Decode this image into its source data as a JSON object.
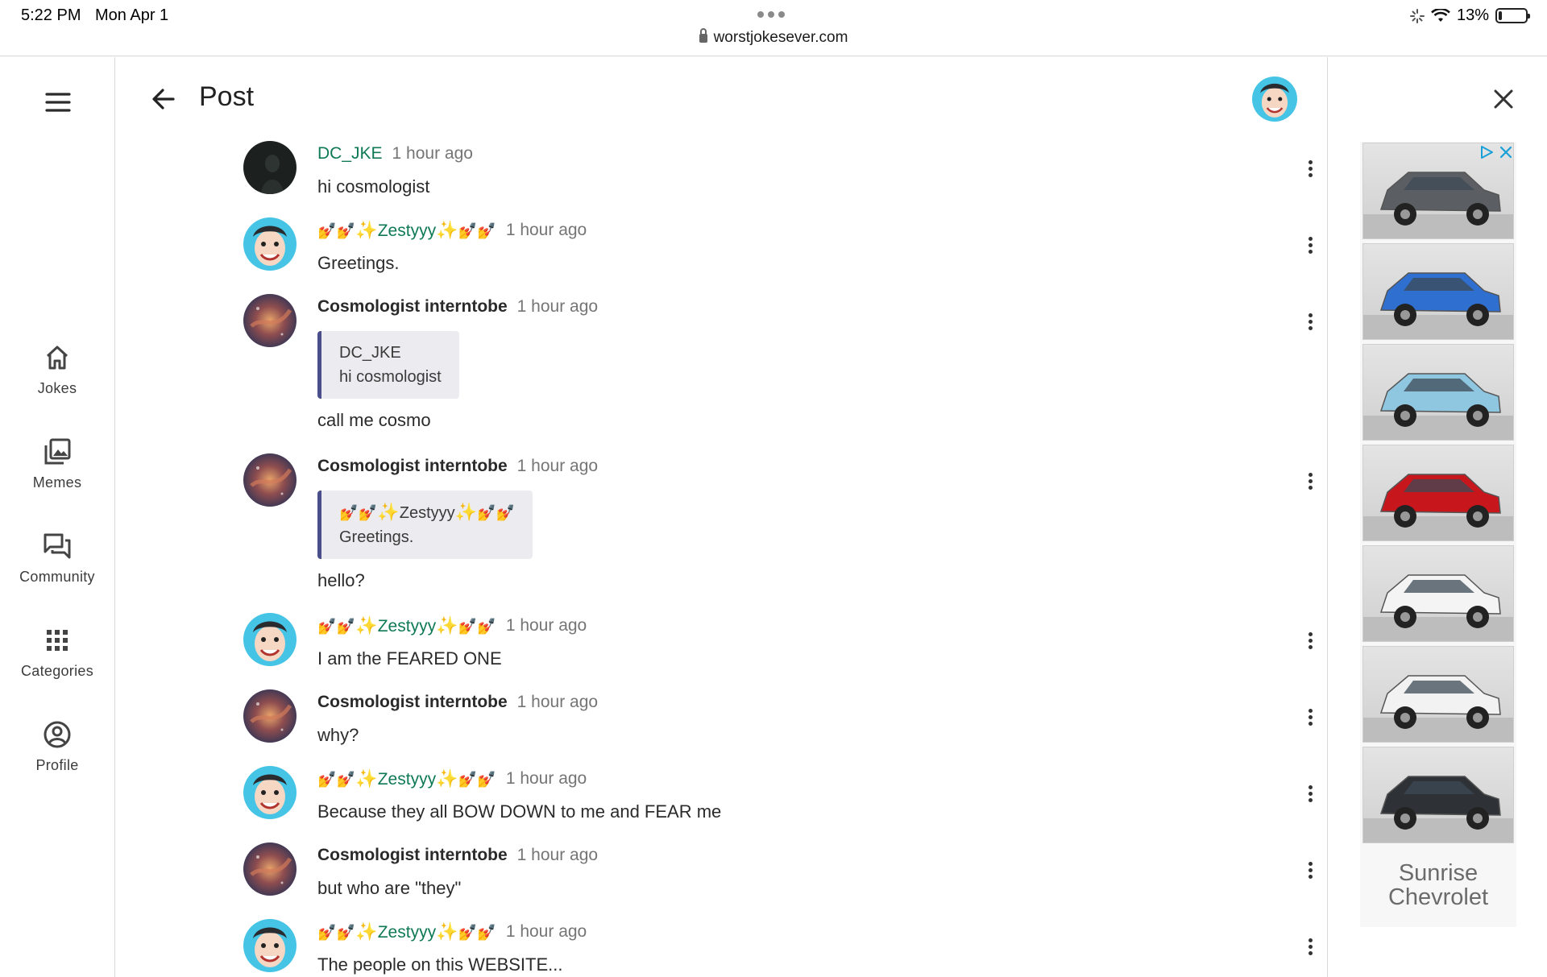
{
  "status_bar": {
    "time": "5:22 PM",
    "date": "Mon Apr 1",
    "url": "worstjokesever.com",
    "battery": "13%",
    "battery_level": 0.13
  },
  "header": {
    "title": "Post"
  },
  "nav": [
    {
      "label": "Jokes",
      "icon": "home-icon"
    },
    {
      "label": "Memes",
      "icon": "image-library-icon"
    },
    {
      "label": "Community",
      "icon": "forum-icon"
    },
    {
      "label": "Categories",
      "icon": "apps-grid-icon"
    },
    {
      "label": "Profile",
      "icon": "account-circle-icon"
    }
  ],
  "messages": [
    {
      "author": "DC_JKE",
      "time": "1 hour ago",
      "text": "hi cosmologist"
    },
    {
      "author": "Zestyyy",
      "time": "1 hour ago",
      "text": "Greetings."
    },
    {
      "author": "Cosmologist interntobe",
      "time": "1 hour ago",
      "quote_author": "DC_JKE",
      "quote_text": "hi cosmologist",
      "text": "call me cosmo"
    },
    {
      "author": "Cosmologist interntobe",
      "time": "1 hour ago",
      "quote_author": "Zestyyy",
      "quote_text": "Greetings.",
      "text": "hello?"
    },
    {
      "author": "Zestyyy",
      "time": "1 hour ago",
      "text": "I am the FEARED ONE"
    },
    {
      "author": "Cosmologist interntobe",
      "time": "1 hour ago",
      "text": "why?"
    },
    {
      "author": "Zestyyy",
      "time": "1 hour ago",
      "text": "Because they all BOW DOWN to me and FEAR me"
    },
    {
      "author": "Cosmologist interntobe",
      "time": "1 hour ago",
      "text": "but who are \"they\""
    },
    {
      "author": "Zestyyy",
      "time": "1 hour ago",
      "text": "The people on this WEBSITE..."
    }
  ],
  "ad": {
    "brand": "Sunrise Chevrolet",
    "car_colors": [
      "#5b5f63",
      "#2f6fd0",
      "#8fc6e0",
      "#c8161d",
      "#f4f4f4",
      "#f2f2f2",
      "#2e3136"
    ]
  },
  "colors": {
    "author_green": "#0f7a55",
    "quote_bar": "#4a4f8c"
  }
}
